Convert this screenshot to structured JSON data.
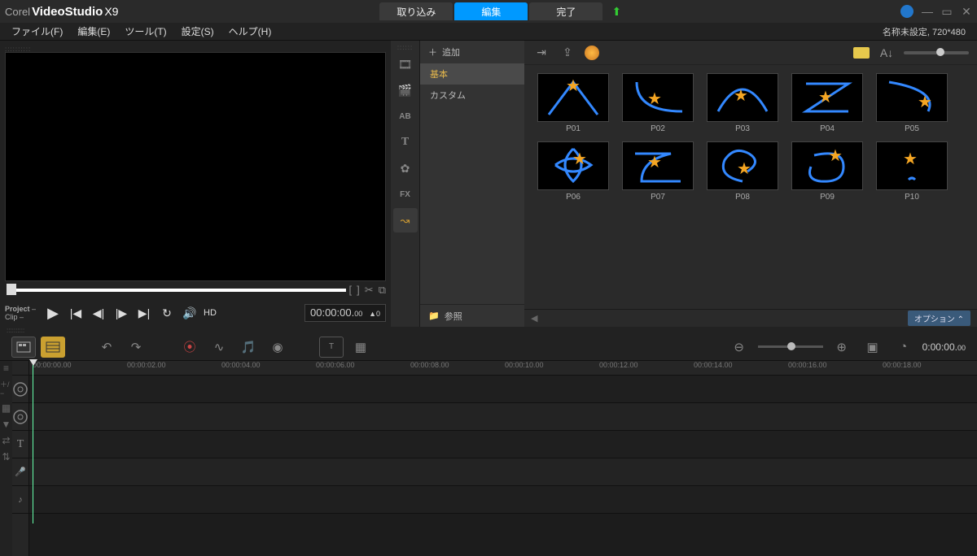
{
  "title": {
    "brand": "Corel",
    "product": "VideoStudio",
    "version": "X9"
  },
  "main_tabs": {
    "capture": "取り込み",
    "edit": "編集",
    "share": "完了"
  },
  "menubar": {
    "file": "ファイル(F)",
    "edit": "編集(E)",
    "tool": "ツール(T)",
    "settings": "設定(S)",
    "help": "ヘルプ(H)",
    "status": "名称未設定, 720*480"
  },
  "preview": {
    "mode_project": "Project",
    "mode_clip": "Clip",
    "hd": "HD",
    "timecode_main": "00:00:00.",
    "timecode_frames": "00",
    "timecode_step": "0"
  },
  "library": {
    "add": "追加",
    "categories": {
      "basic": "基本",
      "custom": "カスタム"
    },
    "browse": "参照",
    "options": "オプション ⌃",
    "items": [
      {
        "id": "P01"
      },
      {
        "id": "P02"
      },
      {
        "id": "P03"
      },
      {
        "id": "P04"
      },
      {
        "id": "P05"
      },
      {
        "id": "P06"
      },
      {
        "id": "P07"
      },
      {
        "id": "P08"
      },
      {
        "id": "P09"
      },
      {
        "id": "P10"
      }
    ]
  },
  "timeline": {
    "timecode_main": "0:00:00.",
    "timecode_frames": "00",
    "ruler": [
      "00:00:00.00",
      "00:00:02.00",
      "00:00:04.00",
      "00:00:06.00",
      "00:00:08.00",
      "00:00:10.00",
      "00:00:12.00",
      "00:00:14.00",
      "00:00:16.00",
      "00:00:18.00"
    ]
  }
}
